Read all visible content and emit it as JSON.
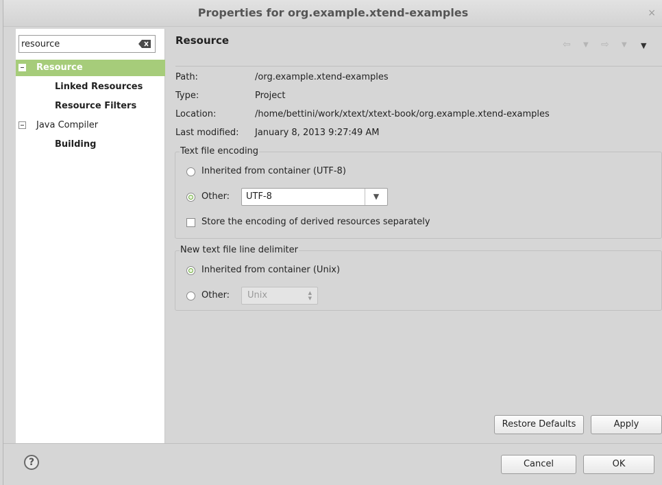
{
  "window": {
    "title": "Properties for org.example.xtend-examples",
    "close_glyph": "×"
  },
  "sidebar": {
    "filter_value": "resource",
    "tree": [
      {
        "label": "Resource",
        "selected": true,
        "expanded": true
      },
      {
        "label": "Linked Resources",
        "child": true
      },
      {
        "label": "Resource Filters",
        "child": true
      },
      {
        "label": "Java Compiler",
        "expanded": true
      },
      {
        "label": "Building",
        "child": true
      }
    ]
  },
  "page": {
    "title": "Resource",
    "nav_icons": [
      "back-arrow-icon",
      "back-menu-icon",
      "forward-arrow-icon",
      "forward-menu-icon",
      "view-menu-icon"
    ],
    "properties": [
      {
        "label": "Path:",
        "value": "/org.example.xtend-examples"
      },
      {
        "label": "Type:",
        "value": "Project"
      },
      {
        "label": "Location:",
        "value": "/home/bettini/work/xtext/xtext-book/org.example.xtend-examples"
      },
      {
        "label": "Last modified:",
        "value": "January 8, 2013 9:27:49 AM"
      }
    ],
    "encoding": {
      "legend": "Text file encoding",
      "inherited_label": "Inherited from container (UTF-8)",
      "other_label": "Other:",
      "other_value": "UTF-8",
      "selected": "other",
      "store_separately_label": "Store the encoding of derived resources separately",
      "store_separately_checked": false
    },
    "line_delimiter": {
      "legend": "New text file line delimiter",
      "inherited_label": "Inherited from container (Unix)",
      "other_label": "Other:",
      "other_value": "Unix",
      "selected": "inherited"
    },
    "restore_defaults_label": "Restore Defaults",
    "apply_label": "Apply"
  },
  "footer": {
    "help_glyph": "?",
    "cancel_label": "Cancel",
    "ok_label": "OK"
  },
  "colors": {
    "selection": "#a6cc7a",
    "radio_accent": "#6aaa3a"
  }
}
